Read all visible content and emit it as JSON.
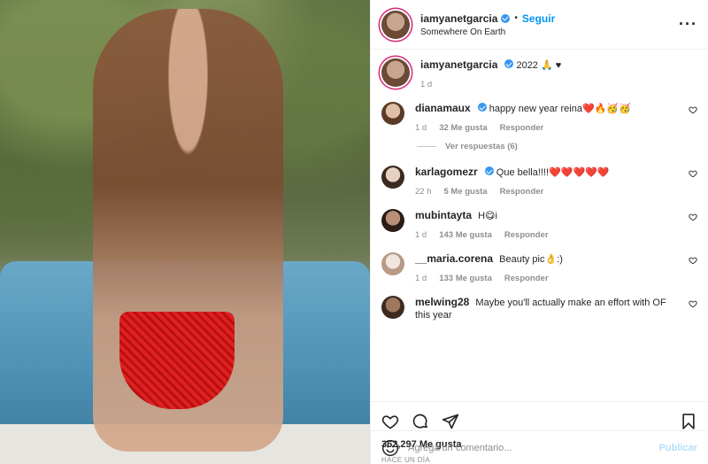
{
  "post": {
    "author": "iamyanetgarcia",
    "follow_label": "Seguir",
    "location": "Somewhere On Earth",
    "caption": "2022 🙏 ♥",
    "caption_time": "1 d"
  },
  "comments": [
    {
      "user": "dianamaux",
      "verified": true,
      "text": "happy new year reina❤️🔥🥳🥳",
      "time": "1 d",
      "likes": "32 Me gusta",
      "reply": "Responder",
      "replies_label": "Ver respuestas (6)"
    },
    {
      "user": "karlagomezr",
      "verified": true,
      "text": "Que bella!!!!❤️❤️❤️❤️❤️",
      "time": "22 h",
      "likes": "5 Me gusta",
      "reply": "Responder"
    },
    {
      "user": "mubintayta",
      "verified": false,
      "text": "H😋i",
      "time": "1 d",
      "likes": "143 Me gusta",
      "reply": "Responder"
    },
    {
      "user": "__maria.corena",
      "verified": false,
      "text": "Beauty pic👌:)",
      "time": "1 d",
      "likes": "133 Me gusta",
      "reply": "Responder"
    },
    {
      "user": "melwing28",
      "verified": false,
      "text": "Maybe you'll actually make an effort with OF this year"
    }
  ],
  "stats": {
    "likes": "362,297 Me gusta",
    "when": "HACE UN DÍA"
  },
  "composer": {
    "placeholder": "Agrega un comentario...",
    "publish_label": "Publicar"
  },
  "colors": {
    "verified": "#3897f0",
    "follow": "#0095f6",
    "publish_disabled": "#b2dffc",
    "muted": "#8e8e8e"
  },
  "icons": [
    "more-options-icon",
    "like-icon",
    "comment-icon",
    "share-icon",
    "save-icon",
    "emoji-icon",
    "verified-badge-icon"
  ]
}
